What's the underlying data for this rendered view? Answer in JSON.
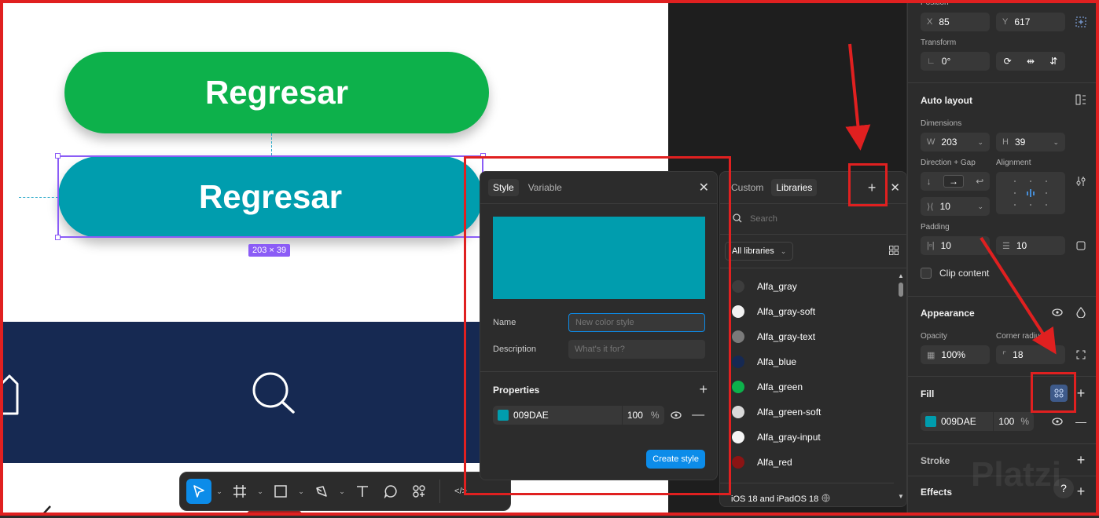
{
  "canvas": {
    "green_button_label": "Regresar",
    "teal_button_label": "Regresar",
    "selection_size": "203 × 39",
    "colors": {
      "green": "#0db14b",
      "teal": "#009dae",
      "navy": "#162952",
      "selection": "#8b5cf6"
    }
  },
  "toolbar": {
    "icons": [
      "cursor-icon",
      "frame-icon",
      "rectangle-icon",
      "pen-icon",
      "text-icon",
      "comment-icon",
      "actions-icon",
      "code-icon"
    ]
  },
  "style_panel": {
    "tab_style": "Style",
    "tab_variable": "Variable",
    "swatch_color": "#009dae",
    "name_label": "Name",
    "name_placeholder": "New color style",
    "description_label": "Description",
    "description_placeholder": "What's it for?",
    "properties_label": "Properties",
    "hex": "009DAE",
    "opacity": "100",
    "percent": "%",
    "create_button": "Create style"
  },
  "library_panel": {
    "tab_custom": "Custom",
    "tab_libraries": "Libraries",
    "search_placeholder": "Search",
    "filter": "All libraries",
    "items": [
      {
        "label": "Alfa_gray",
        "color": "#3d3d3d"
      },
      {
        "label": "Alfa_gray-soft",
        "color": "#f2f2f2"
      },
      {
        "label": "Alfa_gray-text",
        "color": "#7a7a7a"
      },
      {
        "label": "Alfa_blue",
        "color": "#162952"
      },
      {
        "label": "Alfa_green",
        "color": "#0db14b"
      },
      {
        "label": "Alfa_green-soft",
        "color": "#d9d9d9"
      },
      {
        "label": "Alfa_gray-input",
        "color": "#f5f5f5"
      },
      {
        "label": "Alfa_red",
        "color": "#8b1414"
      }
    ],
    "footer": "iOS 18 and iPadOS 18"
  },
  "properties": {
    "position_label": "Position",
    "x_label": "X",
    "x_value": "85",
    "y_label": "Y",
    "y_value": "617",
    "transform_label": "Transform",
    "rotation": "0°",
    "auto_layout_label": "Auto layout",
    "dimensions_label": "Dimensions",
    "w_label": "W",
    "w_value": "203",
    "h_label": "H",
    "h_value": "39",
    "direction_gap_label": "Direction + Gap",
    "alignment_label": "Alignment",
    "gap_value": "10",
    "padding_label": "Padding",
    "padding_h": "10",
    "padding_v": "10",
    "clip_content_label": "Clip content",
    "appearance_label": "Appearance",
    "opacity_label": "Opacity",
    "opacity_value": "100%",
    "corner_radius_label": "Corner radius",
    "corner_radius_value": "18",
    "fill_label": "Fill",
    "fill_hex": "009DAE",
    "fill_opacity": "100",
    "fill_percent": "%",
    "stroke_label": "Stroke",
    "effects_label": "Effects",
    "help": "?"
  },
  "watermark": "Platzi"
}
